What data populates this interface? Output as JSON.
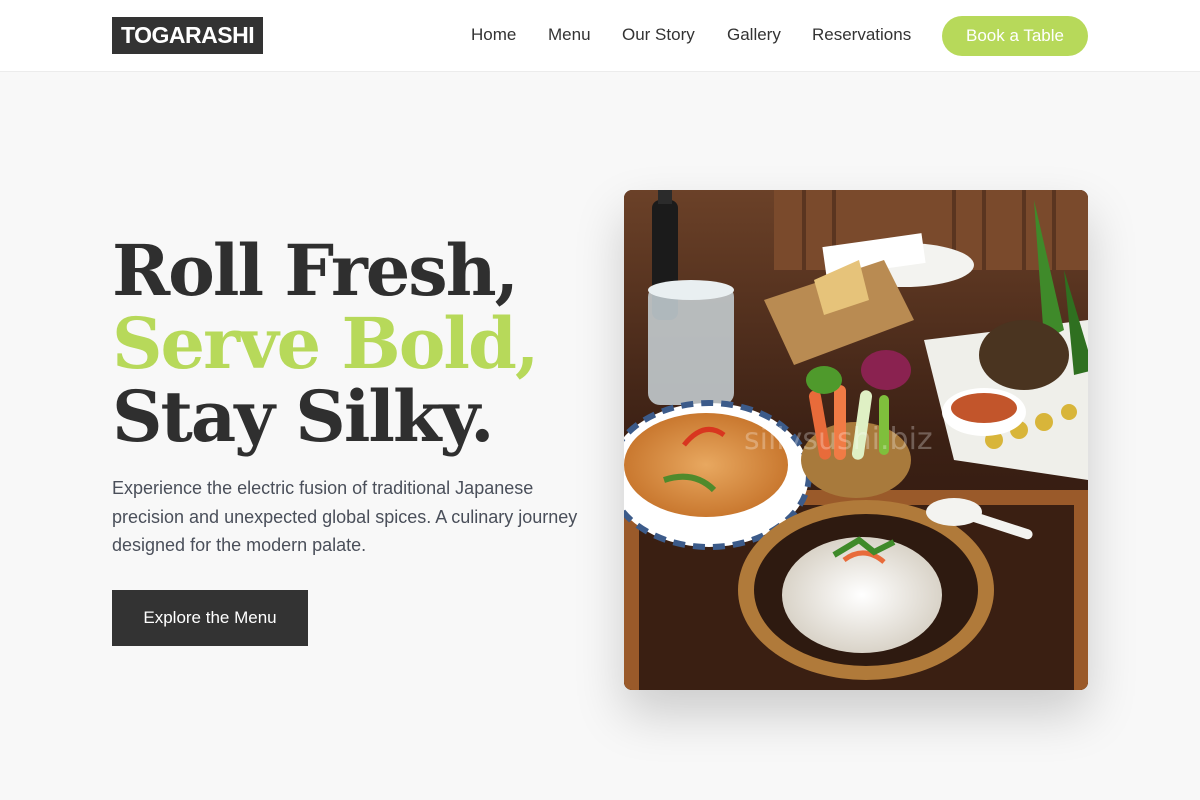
{
  "header": {
    "logo": "TOGARASHI",
    "nav": [
      {
        "label": "Home"
      },
      {
        "label": "Menu"
      },
      {
        "label": "Our Story"
      },
      {
        "label": "Gallery"
      },
      {
        "label": "Reservations"
      }
    ],
    "book_label": "Book a Table"
  },
  "hero": {
    "line1": "Roll Fresh,",
    "line2": "Serve Bold,",
    "line3": "Stay Silky.",
    "subtitle": "Experience the electric fusion of traditional Japanese precision and unexpected global spices. A culinary journey designed for the modern palate.",
    "cta_label": "Explore the Menu",
    "image_watermark": "sillysushi.biz"
  },
  "colors": {
    "accent": "#b7d95a",
    "dark": "#333333",
    "background": "#f8f8f8"
  }
}
